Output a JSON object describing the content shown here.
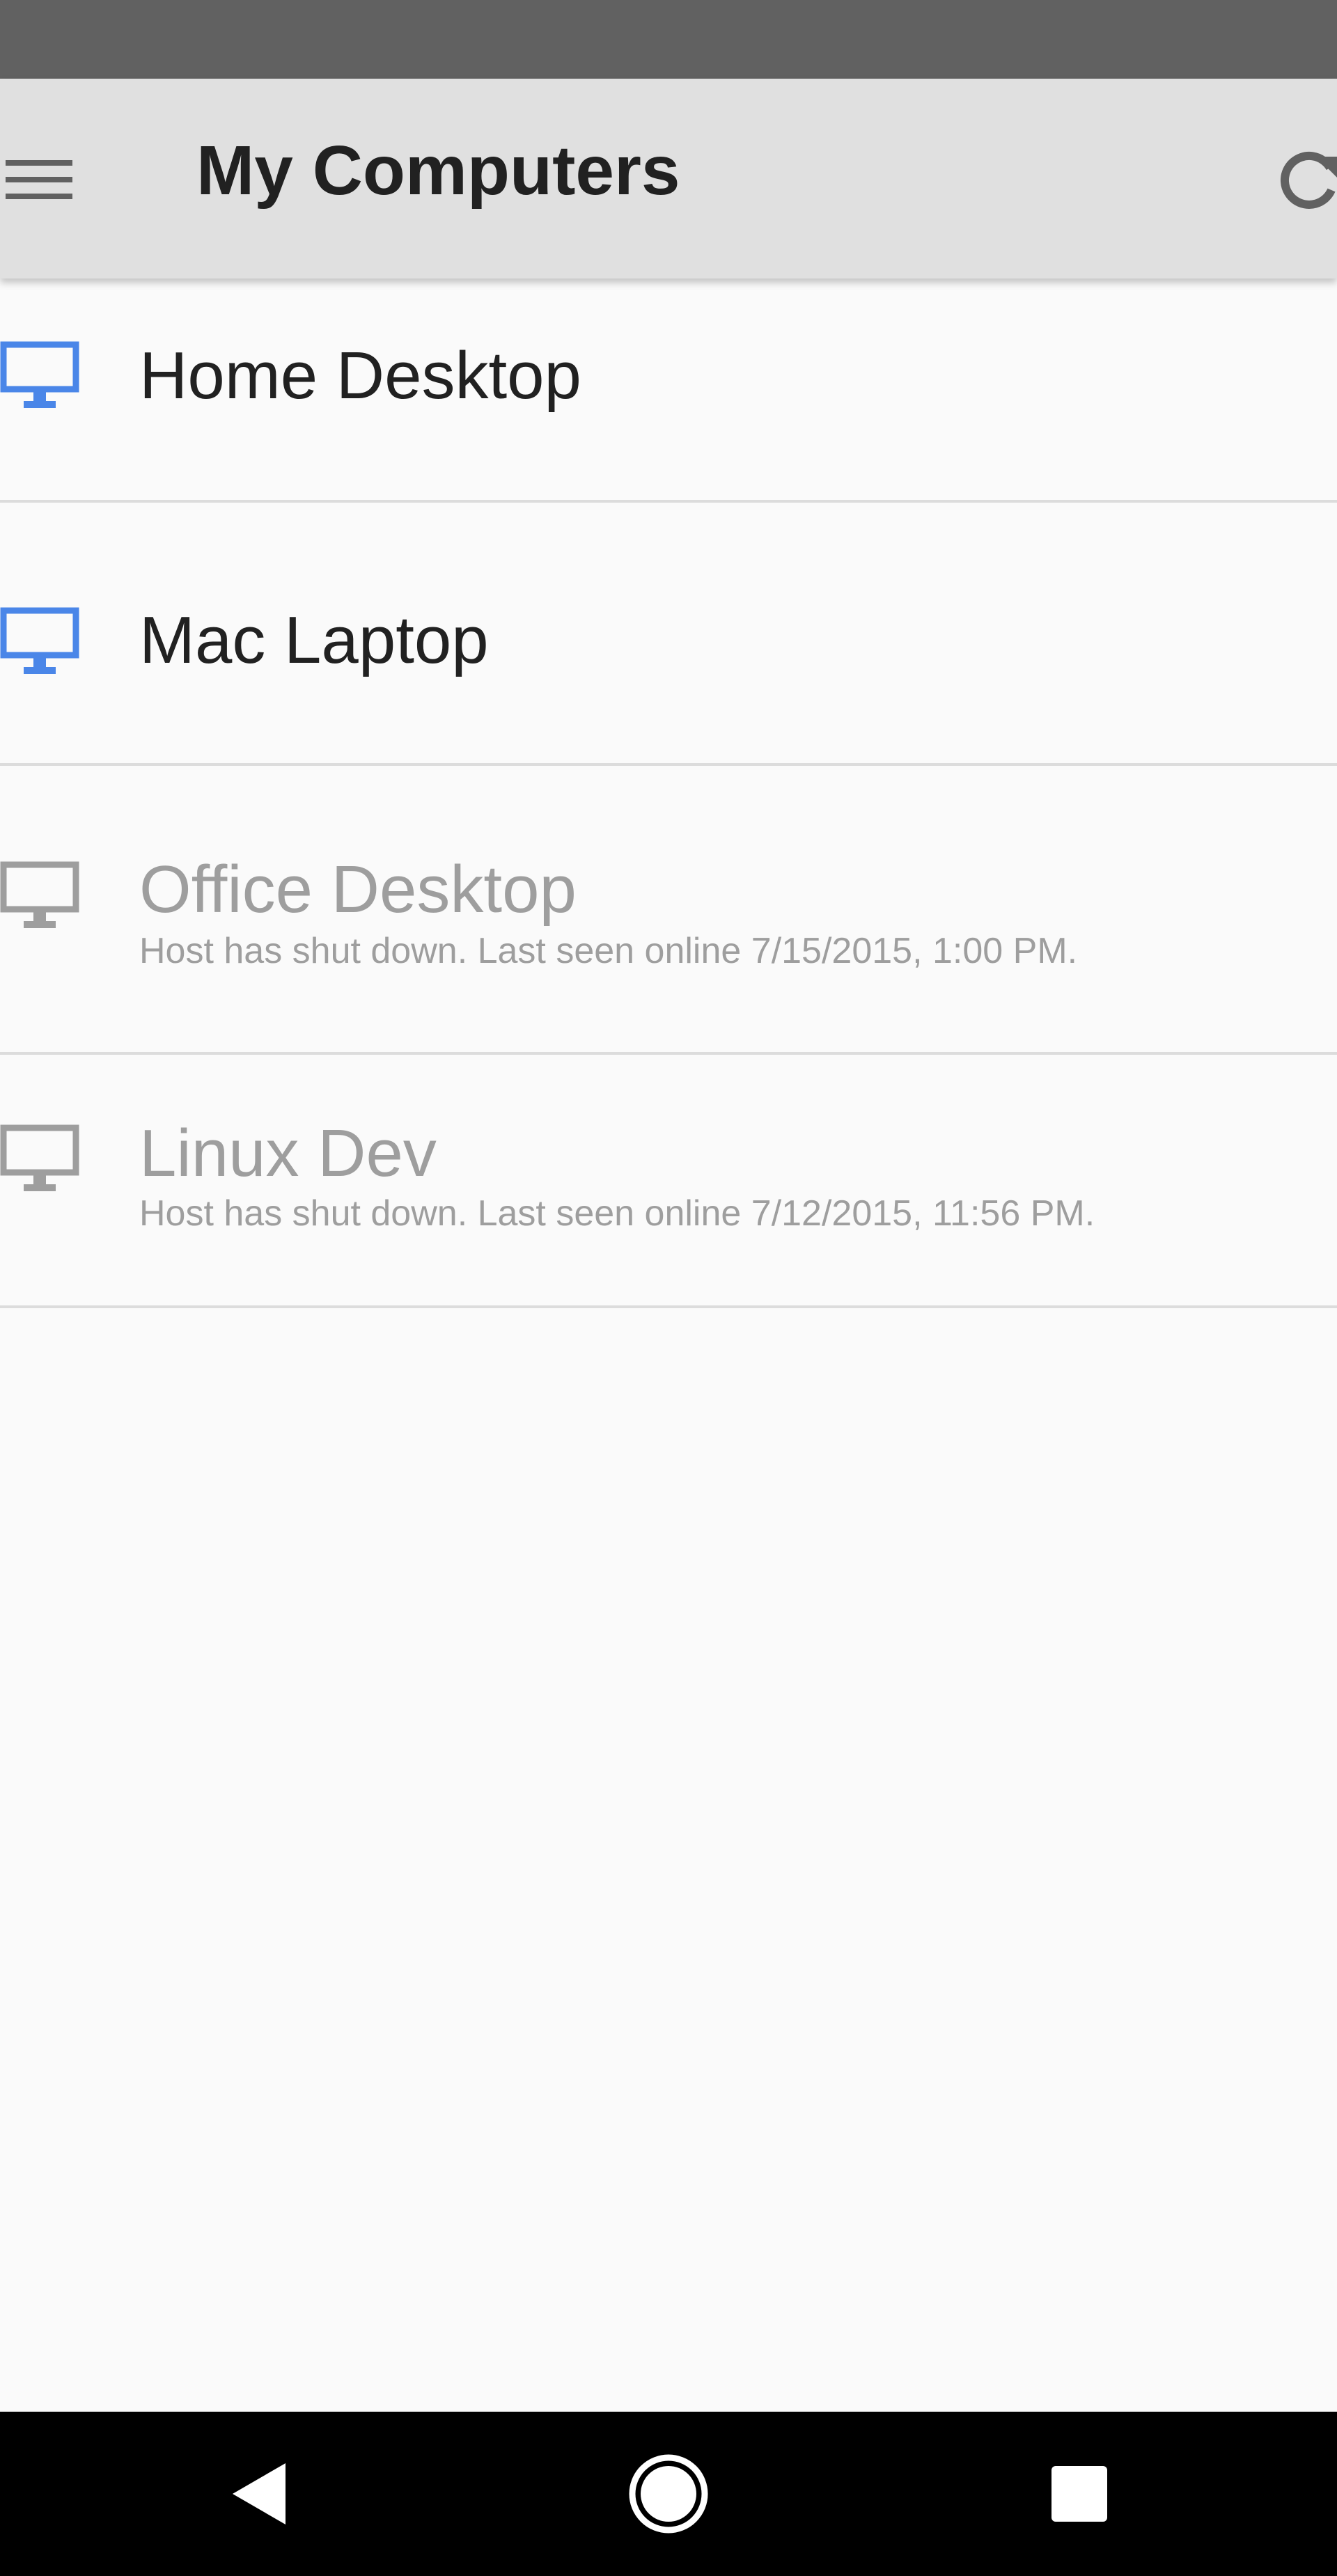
{
  "app_bar": {
    "title": "My Computers",
    "menu_icon": "hamburger-menu-icon",
    "refresh_icon": "refresh-icon"
  },
  "computers": [
    {
      "name": "Home Desktop",
      "status": "",
      "online": true
    },
    {
      "name": "Mac Laptop",
      "status": "",
      "online": true
    },
    {
      "name": "Office Desktop",
      "status": "Host has shut down. Last seen online 7/15/2015, 1:00 PM.",
      "online": false
    },
    {
      "name": "Linux Dev",
      "status": "Host has shut down. Last seen online 7/12/2015, 11:56 PM.",
      "online": false
    }
  ],
  "colors": {
    "status_bar": "#616161",
    "app_bar": "#e0e0e0",
    "background": "#fafafa",
    "online_icon": "#4a86e8",
    "offline": "#9e9e9e",
    "title_text": "#212121",
    "nav_bar": "#000000"
  },
  "nav_bar": {
    "back_icon": "back-triangle-icon",
    "home_icon": "home-circle-icon",
    "recents_icon": "recents-square-icon"
  }
}
